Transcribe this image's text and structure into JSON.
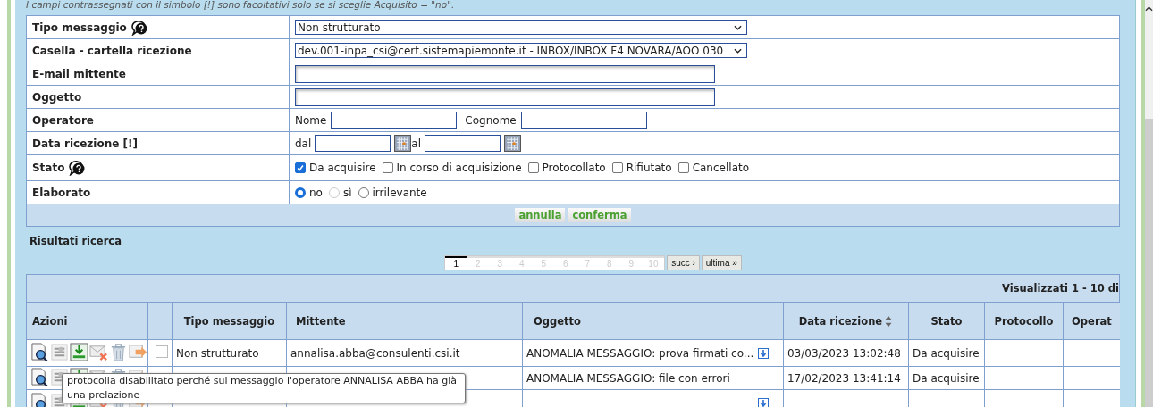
{
  "hint": "I campi contrassegnati con il simbolo [!] sono facoltativi solo se si sceglie Acquisito = \"no\".",
  "form": {
    "rows": [
      {
        "label": "Tipo messaggio",
        "help": true,
        "kind": "select",
        "value": "Non strutturato"
      },
      {
        "label": "Casella - cartella ricezione",
        "kind": "select",
        "value": "dev.001-inpa_csi@cert.sistemapiemonte.it - INBOX/INBOX F4 NOVARA/AOO 030"
      },
      {
        "label": "E-mail mittente",
        "kind": "text"
      },
      {
        "label": "Oggetto",
        "kind": "text"
      },
      {
        "label": "Operatore",
        "kind": "pair",
        "fields": [
          {
            "label": "Nome"
          },
          {
            "label": "Cognome"
          }
        ]
      },
      {
        "label": "Data ricezione [!]",
        "kind": "date",
        "fields": [
          {
            "label": "dal"
          },
          {
            "label": "al"
          }
        ]
      },
      {
        "label": "Stato",
        "help": true,
        "kind": "checks",
        "options": [
          {
            "label": "Da acquisire",
            "checked": true
          },
          {
            "label": "In corso di acquisizione",
            "checked": false
          },
          {
            "label": "Protocollato",
            "checked": false
          },
          {
            "label": "Rifiutato",
            "checked": false
          },
          {
            "label": "Cancellato",
            "checked": false
          }
        ]
      },
      {
        "label": "Elaborato",
        "kind": "radios",
        "options": [
          {
            "label": "no",
            "selected": true,
            "disabled": false
          },
          {
            "label": "sì",
            "selected": false,
            "disabled": true
          },
          {
            "label": "irrilevante",
            "selected": false,
            "disabled": false
          }
        ]
      }
    ]
  },
  "buttons": [
    "annulla",
    "conferma"
  ],
  "results": {
    "title": "Risultati ricerca",
    "pages": [
      {
        "label": "1",
        "selected": true
      },
      {
        "label": "2",
        "selected": false
      },
      {
        "label": "3",
        "selected": false
      },
      {
        "label": "4",
        "selected": false
      },
      {
        "label": "5",
        "selected": false
      },
      {
        "label": "6",
        "selected": false
      },
      {
        "label": "7",
        "selected": false
      },
      {
        "label": "8",
        "selected": false
      },
      {
        "label": "9",
        "selected": false
      },
      {
        "label": "10",
        "selected": false
      }
    ],
    "next": "succ ›",
    "last": "ultima »",
    "summary": "Visualizzati 1 - 10 di",
    "columns": [
      {
        "label": "Azioni",
        "sortable": false
      },
      {
        "label": "Tipo messaggio",
        "sortable": false
      },
      {
        "label": "Mittente",
        "sortable": false
      },
      {
        "label": "Oggetto",
        "sortable": false
      },
      {
        "label": "Data ricezione",
        "sortable": true
      },
      {
        "label": "Stato",
        "sortable": false
      },
      {
        "label": "Protocollo",
        "sortable": false
      },
      {
        "label": "Operat",
        "sortable": false
      }
    ],
    "rows": [
      {
        "checked": false,
        "tipo": "Non strutturato",
        "mittente": "annalisa.abba@consulenti.csi.it",
        "oggetto": "ANOMALIA MESSAGGIO: prova firmati co...",
        "attachment": true,
        "data": "03/03/2023 13:02:48",
        "stato": "Da acquisire"
      },
      {
        "oggetto": "ANOMALIA MESSAGGIO: file con errori",
        "attachment": false,
        "data": "17/02/2023 13:41:14",
        "stato": "Da acquisire"
      },
      {
        "attachment": true
      }
    ]
  },
  "tooltip": "protocolla disabilitato perché sul messaggio l'operatore ANNALISA ABBA ha già una prelazione"
}
